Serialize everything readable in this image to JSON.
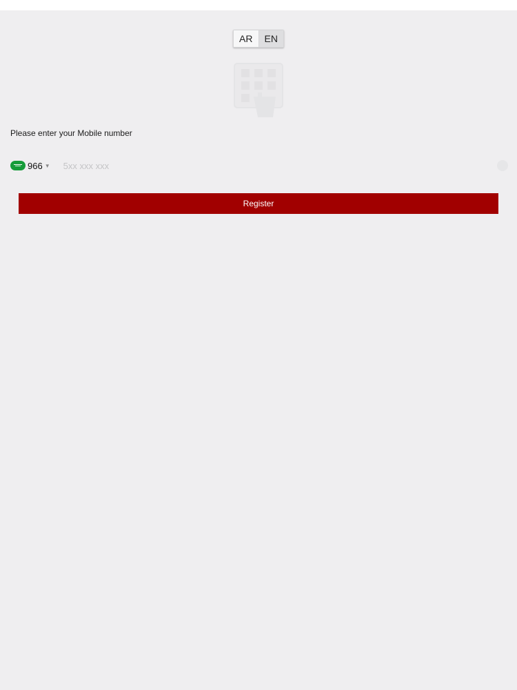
{
  "language_toggle": {
    "options": [
      "AR",
      "EN"
    ],
    "selected": "EN"
  },
  "logo": {
    "icon": "building-hand-icon"
  },
  "form": {
    "prompt": "Please enter your Mobile number",
    "country": {
      "flag_icon": "saudi-flag-icon",
      "dial_code": "966"
    },
    "phone": {
      "value": "",
      "placeholder": "5xx xxx xxx"
    },
    "register_label": "Register"
  },
  "colors": {
    "background": "#efeef0",
    "primary": "#a10000",
    "flag": "#169c3a"
  }
}
